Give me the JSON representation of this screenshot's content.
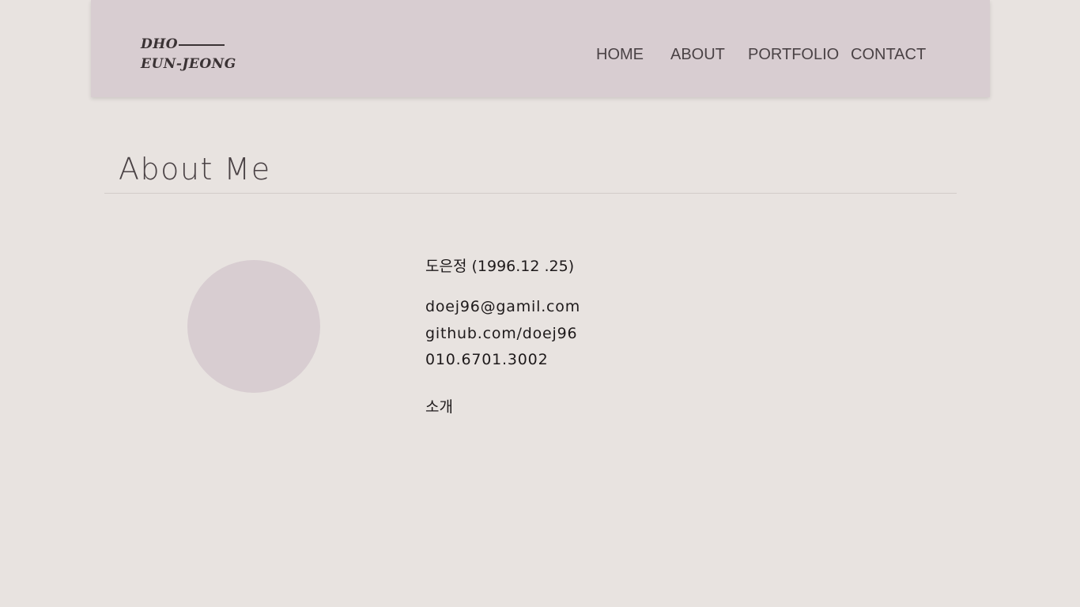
{
  "logo": {
    "line1": "DHO",
    "line2": "EUN-JEONG"
  },
  "nav": {
    "home": "HOME",
    "about": "ABOUT",
    "portfolio": "PORTFOLIO",
    "contact": "CONTACT"
  },
  "page": {
    "title": "About Me"
  },
  "profile": {
    "name_line": "도은정 (1996.12 .25)",
    "email": "doej96@gamil.com",
    "github": "github.com/doej96",
    "phone": "010.6701.3002",
    "intro_label": "소개"
  },
  "colors": {
    "background": "#e8e3e0",
    "header": "#d8cdd1",
    "avatar": "#d8cdd1",
    "text": "#3d3638"
  }
}
